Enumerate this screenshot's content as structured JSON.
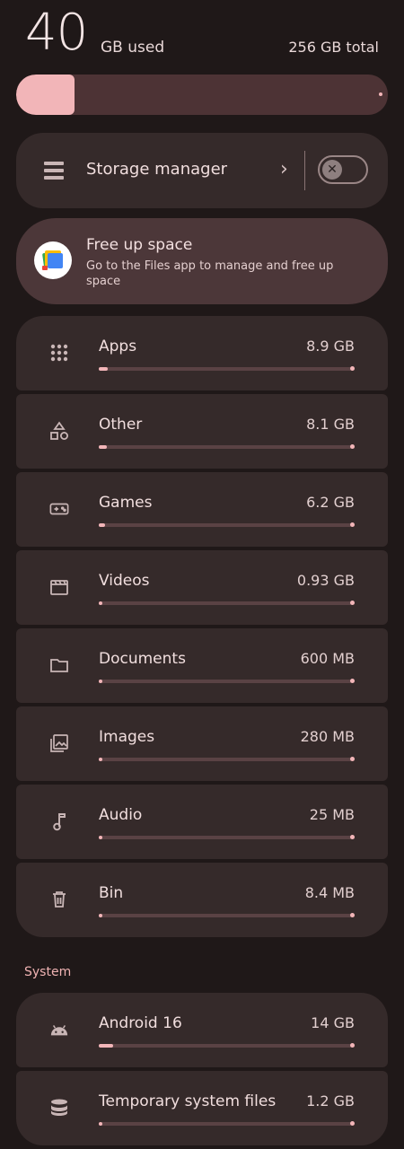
{
  "summary": {
    "used_value": "40",
    "used_unit": "GB used",
    "total": "256 GB total",
    "used_fraction": 0.156
  },
  "storage_manager": {
    "label": "Storage manager",
    "toggle_state": "off"
  },
  "free_up": {
    "title": "Free up space",
    "description": "Go to the Files app to manage and free up space"
  },
  "categories": [
    {
      "name": "Apps",
      "size": "8.9 GB",
      "icon": "apps-grid-icon",
      "fraction": 0.035
    },
    {
      "name": "Other",
      "size": "8.1 GB",
      "icon": "shapes-icon",
      "fraction": 0.032
    },
    {
      "name": "Games",
      "size": "6.2 GB",
      "icon": "gamepad-icon",
      "fraction": 0.024
    },
    {
      "name": "Videos",
      "size": "0.93 GB",
      "icon": "clapperboard-icon",
      "fraction": 0.0
    },
    {
      "name": "Documents",
      "size": "600 MB",
      "icon": "folder-icon",
      "fraction": 0.0
    },
    {
      "name": "Images",
      "size": "280 MB",
      "icon": "image-icon",
      "fraction": 0.0
    },
    {
      "name": "Audio",
      "size": "25 MB",
      "icon": "music-note-icon",
      "fraction": 0.0
    },
    {
      "name": "Bin",
      "size": "8.4 MB",
      "icon": "trash-icon",
      "fraction": 0.0
    }
  ],
  "system": {
    "label": "System",
    "items": [
      {
        "name": "Android 16",
        "size": "14 GB",
        "icon": "android-icon",
        "fraction": 0.055
      },
      {
        "name": "Temporary system files",
        "size": "1.2 GB",
        "icon": "database-icon",
        "fraction": 0.0
      }
    ]
  },
  "colors": {
    "accent": "#f2b5b8",
    "track": "#5a4244",
    "card": "#352a2a",
    "background": "#1f1818"
  }
}
